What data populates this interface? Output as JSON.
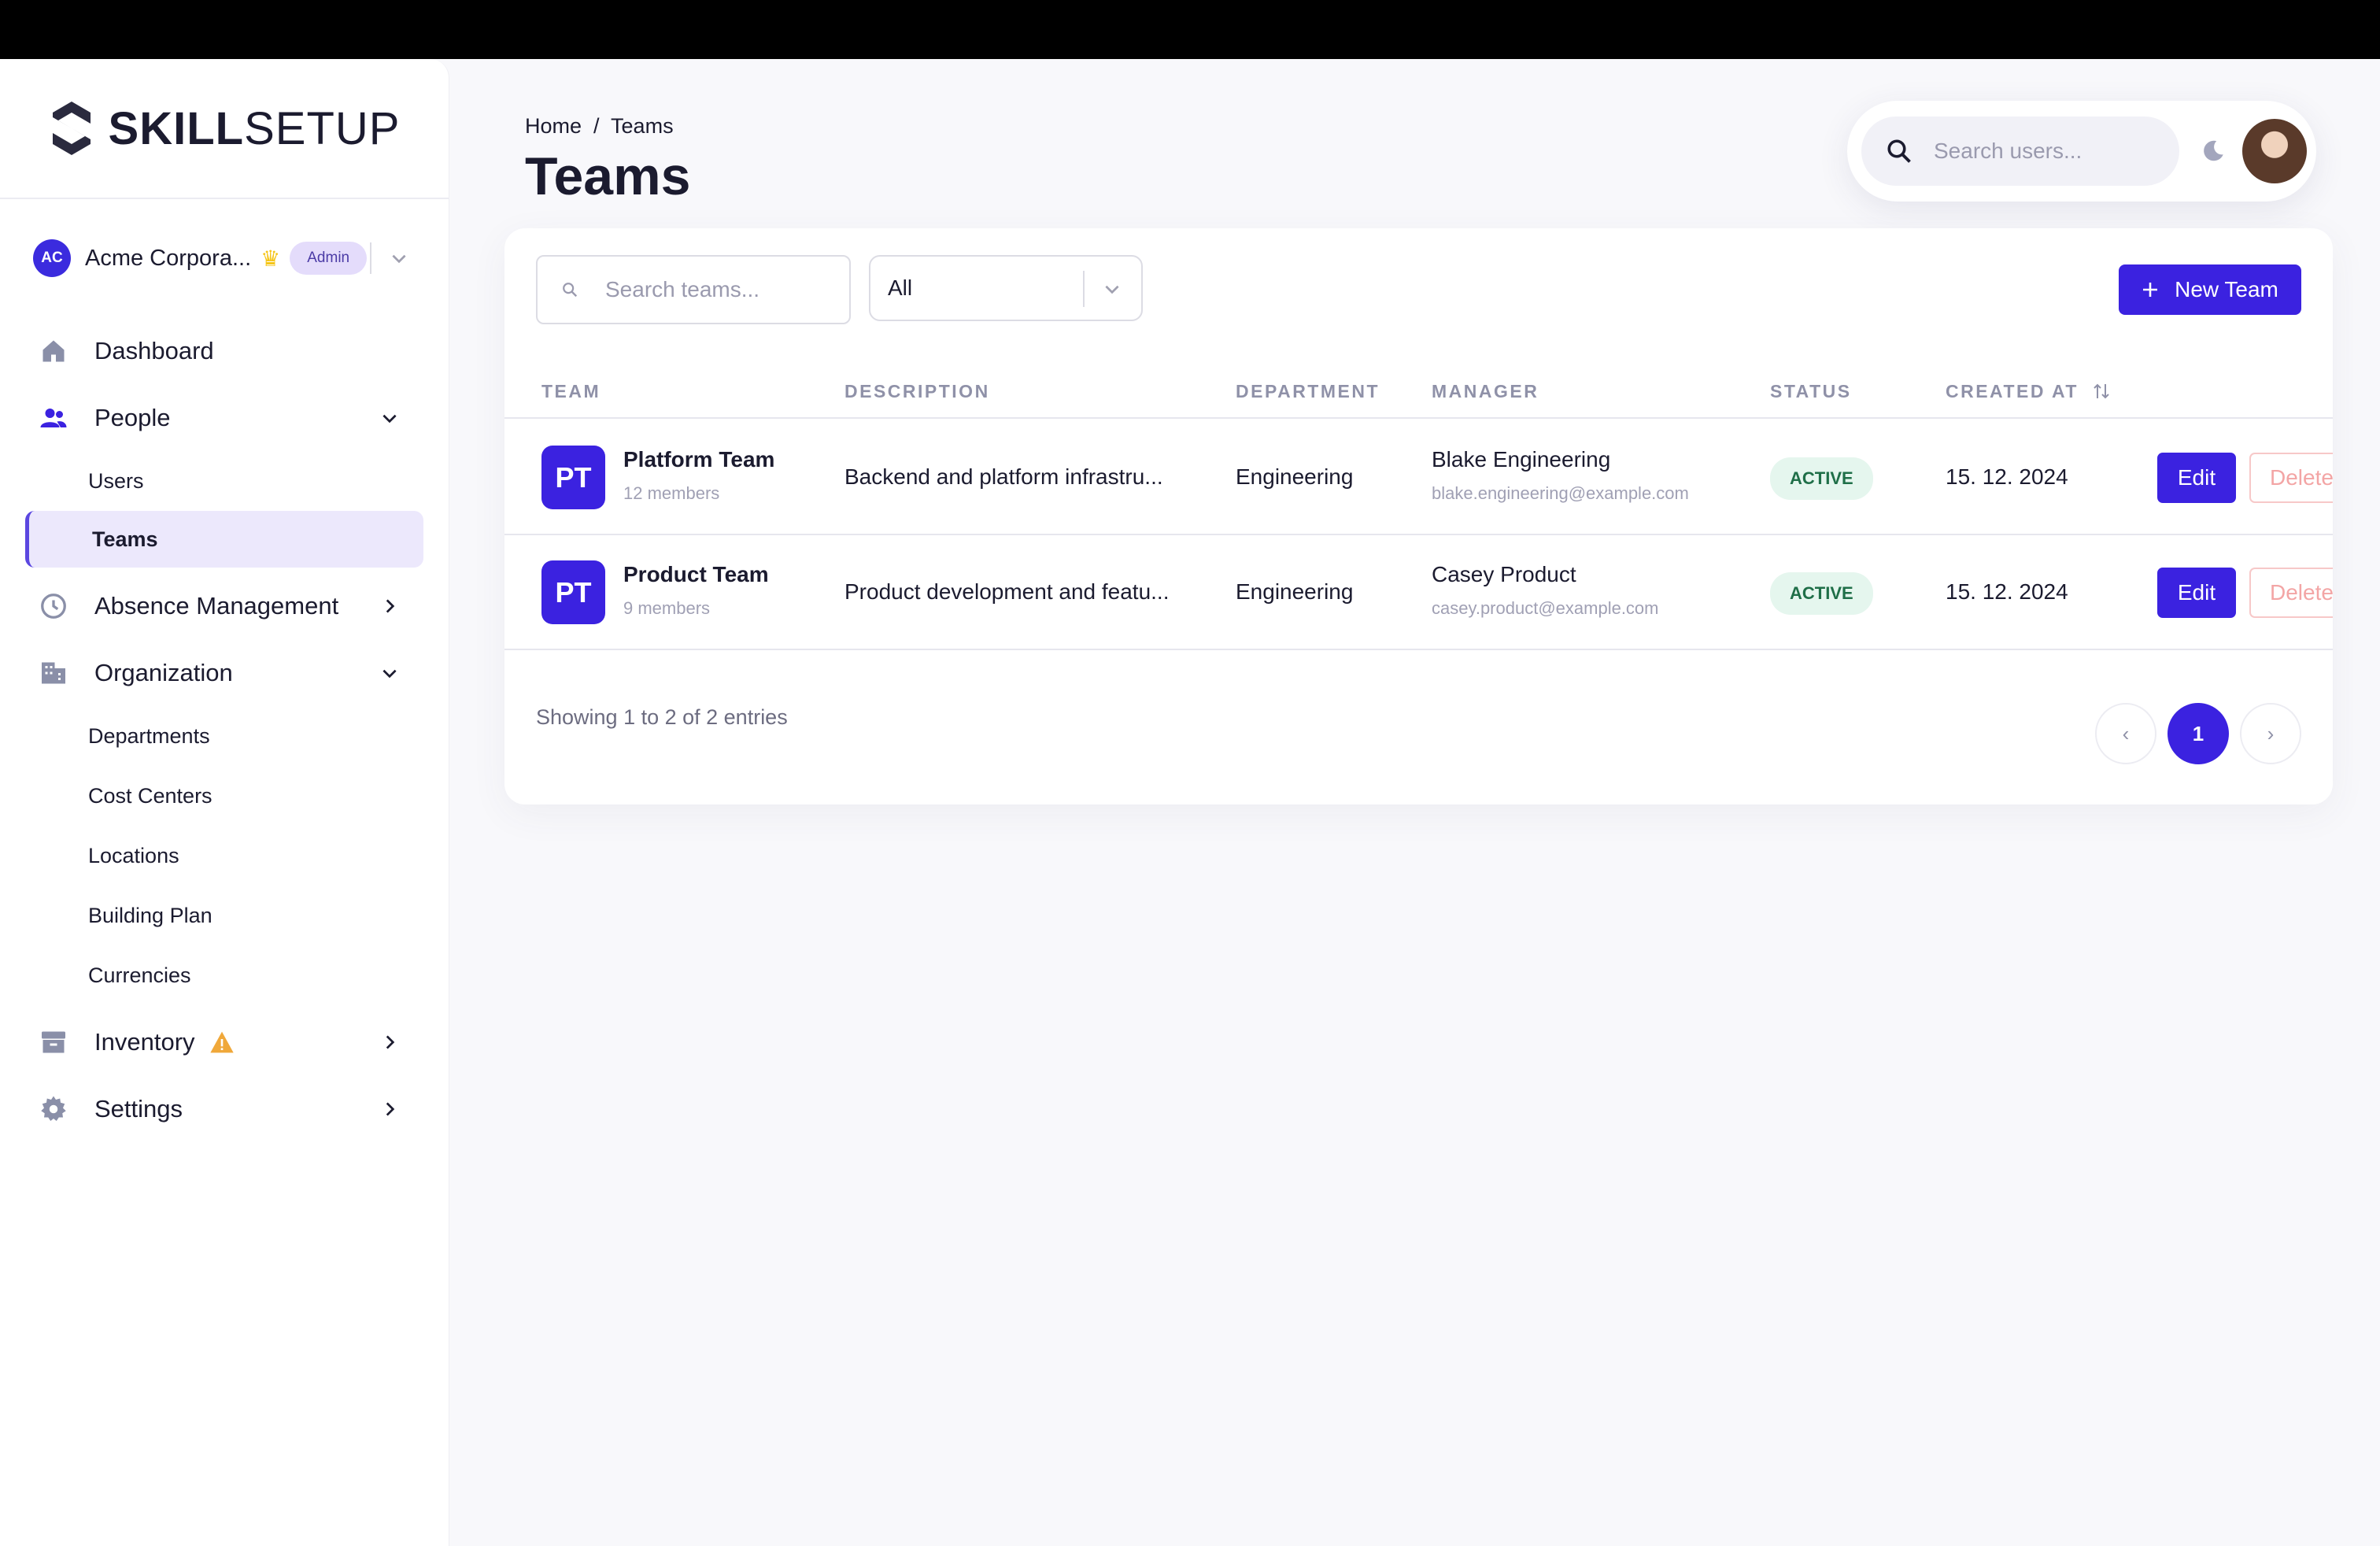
{
  "brand": {
    "name_bold": "SKILL",
    "name_light": "SETUP"
  },
  "org": {
    "initials": "AC",
    "name": "Acme Corpora...",
    "role_badge": "Admin"
  },
  "sidebar": {
    "items": [
      {
        "label": "Dashboard",
        "icon": "home-icon"
      },
      {
        "label": "People",
        "icon": "people-icon",
        "expanded": true,
        "children": [
          {
            "label": "Users"
          },
          {
            "label": "Teams",
            "active": true
          }
        ]
      },
      {
        "label": "Absence Management",
        "icon": "clock-icon"
      },
      {
        "label": "Organization",
        "icon": "building-icon",
        "expanded": true,
        "children": [
          {
            "label": "Departments"
          },
          {
            "label": "Cost Centers"
          },
          {
            "label": "Locations"
          },
          {
            "label": "Building Plan"
          },
          {
            "label": "Currencies"
          }
        ]
      },
      {
        "label": "Inventory",
        "icon": "archive-icon",
        "warning": true
      },
      {
        "label": "Settings",
        "icon": "gear-icon"
      }
    ]
  },
  "header": {
    "breadcrumb": "Home  /  Teams",
    "title": "Teams",
    "search_placeholder": "Search users..."
  },
  "toolbar": {
    "search_placeholder": "Search teams...",
    "filter_value": "All",
    "new_team_label": "New Team"
  },
  "table": {
    "columns": [
      "TEAM",
      "DESCRIPTION",
      "DEPARTMENT",
      "MANAGER",
      "STATUS",
      "CREATED AT"
    ],
    "rows": [
      {
        "initials": "PT",
        "team": "Platform Team",
        "members": "12 members",
        "description": "Backend and platform infrastru...",
        "department": "Engineering",
        "manager": "Blake Engineering",
        "manager_email": "blake.engineering@example.com",
        "status": "ACTIVE",
        "created": "15. 12. 2024",
        "edit": "Edit",
        "delete": "Delete"
      },
      {
        "initials": "PT",
        "team": "Product Team",
        "members": "9 members",
        "description": "Product development and featu...",
        "department": "Engineering",
        "manager": "Casey Product",
        "manager_email": "casey.product@example.com",
        "status": "ACTIVE",
        "created": "15. 12. 2024",
        "edit": "Edit",
        "delete": "Delete"
      }
    ]
  },
  "footer": {
    "info": "Showing 1 to 2 of 2 entries",
    "prev": "‹",
    "page": "1",
    "next": "›"
  },
  "colors": {
    "accent": "#3b22e0",
    "active_status_bg": "#e5f6ee",
    "active_nav_bg": "#ece8fc"
  }
}
